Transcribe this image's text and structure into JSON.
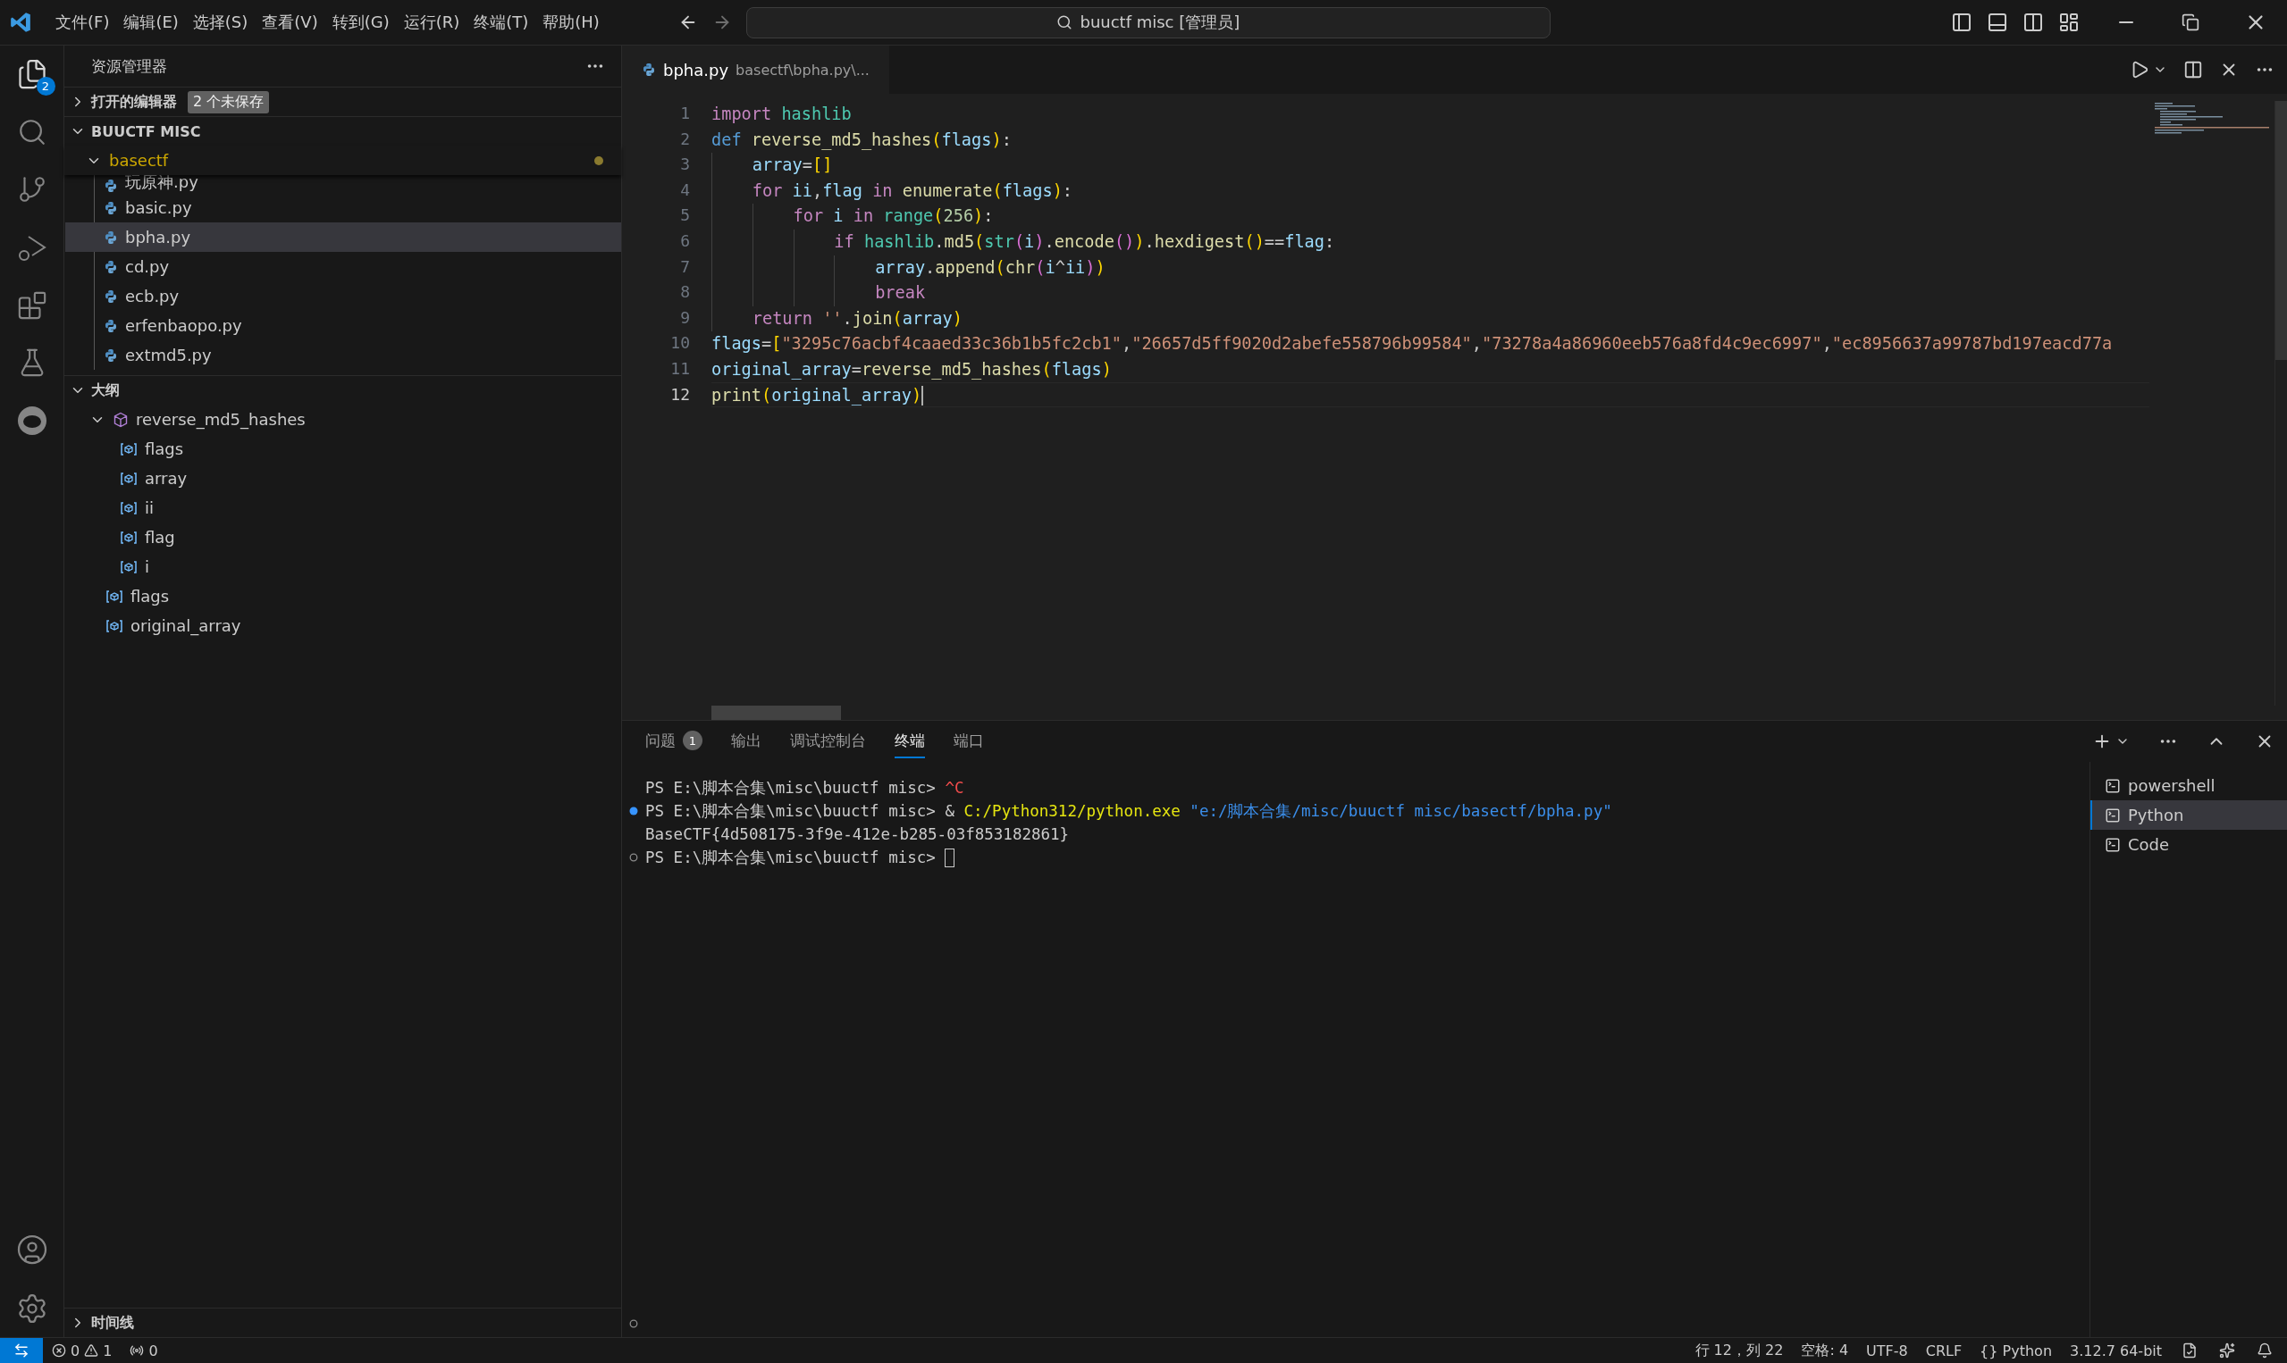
{
  "title_bar": {
    "menus": [
      "文件(F)",
      "编辑(E)",
      "选择(S)",
      "查看(V)",
      "转到(G)",
      "运行(R)",
      "终端(T)",
      "帮助(H)"
    ],
    "search": "buuctf misc [管理员]"
  },
  "activity_bar": {
    "explorer_badge": "2"
  },
  "sidebar": {
    "title": "资源管理器",
    "open_editors": {
      "label": "打开的编辑器",
      "expanded": false,
      "badge": "2 个未保存"
    },
    "workspace": {
      "label": "BUUCTF MISC",
      "expanded": true,
      "folder": {
        "name": "basectf",
        "expanded": true,
        "modified": true,
        "files": [
          {
            "name": "玩原神.py",
            "selected": false
          },
          {
            "name": "basic.py",
            "selected": false
          },
          {
            "name": "bpha.py",
            "selected": true
          },
          {
            "name": "cd.py",
            "selected": false
          },
          {
            "name": "ecb.py",
            "selected": false
          },
          {
            "name": "erfenbaopo.py",
            "selected": false
          },
          {
            "name": "extmd5.py",
            "selected": false
          }
        ]
      }
    },
    "outline": {
      "label": "大纲",
      "expanded": true,
      "items": [
        {
          "name": "reverse_md5_hashes",
          "kind": "method",
          "expanded": true,
          "children": [
            {
              "name": "flags",
              "kind": "variable"
            },
            {
              "name": "array",
              "kind": "variable"
            },
            {
              "name": "ii",
              "kind": "variable"
            },
            {
              "name": "flag",
              "kind": "variable"
            },
            {
              "name": "i",
              "kind": "variable"
            }
          ]
        },
        {
          "name": "flags",
          "kind": "variable"
        },
        {
          "name": "original_array",
          "kind": "variable"
        }
      ]
    },
    "timeline": {
      "label": "时间线",
      "expanded": false
    }
  },
  "editor": {
    "tab": {
      "name": "bpha.py",
      "description": "basectf\\bpha.py\\..."
    },
    "lines": [
      {
        "number": "1",
        "current": false,
        "tokens": [
          {
            "kind": "kw",
            "text": "import "
          },
          {
            "kind": "cls",
            "text": "hashlib"
          }
        ]
      },
      {
        "number": "2",
        "current": false,
        "tokens": [
          {
            "kind": "def",
            "text": "def "
          },
          {
            "kind": "fn",
            "text": "reverse_md5_hashes"
          },
          {
            "kind": "b1",
            "text": "("
          },
          {
            "kind": "var",
            "text": "flags"
          },
          {
            "kind": "b1",
            "text": ")"
          },
          {
            "kind": "plain",
            "text": ":"
          }
        ]
      },
      {
        "number": "3",
        "current": false,
        "tokens": [
          {
            "kind": "var",
            "text": "    array"
          },
          {
            "kind": "plain",
            "text": "="
          },
          {
            "kind": "b1",
            "text": "[]"
          }
        ]
      },
      {
        "number": "4",
        "current": false,
        "tokens": [
          {
            "kind": "kw",
            "text": "    for "
          },
          {
            "kind": "var",
            "text": "ii"
          },
          {
            "kind": "plain",
            "text": ","
          },
          {
            "kind": "var",
            "text": "flag"
          },
          {
            "kind": "kw",
            "text": " in "
          },
          {
            "kind": "fn",
            "text": "enumerate"
          },
          {
            "kind": "b1",
            "text": "("
          },
          {
            "kind": "var",
            "text": "flags"
          },
          {
            "kind": "b1",
            "text": ")"
          },
          {
            "kind": "plain",
            "text": ":"
          }
        ]
      },
      {
        "number": "5",
        "current": false,
        "tokens": [
          {
            "kind": "kw",
            "text": "        for "
          },
          {
            "kind": "var",
            "text": "i"
          },
          {
            "kind": "kw",
            "text": " in "
          },
          {
            "kind": "cls",
            "text": "range"
          },
          {
            "kind": "b1",
            "text": "("
          },
          {
            "kind": "num",
            "text": "256"
          },
          {
            "kind": "b1",
            "text": ")"
          },
          {
            "kind": "plain",
            "text": ":"
          }
        ]
      },
      {
        "number": "6",
        "current": false,
        "tokens": [
          {
            "kind": "kw",
            "text": "            if "
          },
          {
            "kind": "cls",
            "text": "hashlib"
          },
          {
            "kind": "plain",
            "text": "."
          },
          {
            "kind": "fn",
            "text": "md5"
          },
          {
            "kind": "b1",
            "text": "("
          },
          {
            "kind": "cls",
            "text": "str"
          },
          {
            "kind": "b2",
            "text": "("
          },
          {
            "kind": "var",
            "text": "i"
          },
          {
            "kind": "b2",
            "text": ")"
          },
          {
            "kind": "plain",
            "text": "."
          },
          {
            "kind": "fn",
            "text": "encode"
          },
          {
            "kind": "b2",
            "text": "()"
          },
          {
            "kind": "b1",
            "text": ")"
          },
          {
            "kind": "plain",
            "text": "."
          },
          {
            "kind": "fn",
            "text": "hexdigest"
          },
          {
            "kind": "b1",
            "text": "()"
          },
          {
            "kind": "plain",
            "text": "=="
          },
          {
            "kind": "var",
            "text": "flag"
          },
          {
            "kind": "plain",
            "text": ":"
          }
        ]
      },
      {
        "number": "7",
        "current": false,
        "tokens": [
          {
            "kind": "var",
            "text": "                array"
          },
          {
            "kind": "plain",
            "text": "."
          },
          {
            "kind": "fn",
            "text": "append"
          },
          {
            "kind": "b1",
            "text": "("
          },
          {
            "kind": "fn",
            "text": "chr"
          },
          {
            "kind": "b2",
            "text": "("
          },
          {
            "kind": "var",
            "text": "i"
          },
          {
            "kind": "plain",
            "text": "^"
          },
          {
            "kind": "var",
            "text": "ii"
          },
          {
            "kind": "b2",
            "text": ")"
          },
          {
            "kind": "b1",
            "text": ")"
          }
        ]
      },
      {
        "number": "8",
        "current": false,
        "tokens": [
          {
            "kind": "kw",
            "text": "                break"
          }
        ]
      },
      {
        "number": "9",
        "current": false,
        "tokens": [
          {
            "kind": "kw",
            "text": "    return "
          },
          {
            "kind": "str",
            "text": "''"
          },
          {
            "kind": "plain",
            "text": "."
          },
          {
            "kind": "fn",
            "text": "join"
          },
          {
            "kind": "b1",
            "text": "("
          },
          {
            "kind": "var",
            "text": "array"
          },
          {
            "kind": "b1",
            "text": ")"
          }
        ]
      },
      {
        "number": "10",
        "current": false,
        "tokens": [
          {
            "kind": "var",
            "text": "flags"
          },
          {
            "kind": "plain",
            "text": "="
          },
          {
            "kind": "b1",
            "text": "["
          },
          {
            "kind": "str",
            "text": "\"3295c76acbf4caaed33c36b1b5fc2cb1\""
          },
          {
            "kind": "plain",
            "text": ","
          },
          {
            "kind": "str",
            "text": "\"26657d5ff9020d2abefe558796b99584\""
          },
          {
            "kind": "plain",
            "text": ","
          },
          {
            "kind": "str",
            "text": "\"73278a4a86960eeb576a8fd4c9ec6997\""
          },
          {
            "kind": "plain",
            "text": ","
          },
          {
            "kind": "str",
            "text": "\"ec8956637a99787bd197eacd77a"
          }
        ]
      },
      {
        "number": "11",
        "current": false,
        "tokens": [
          {
            "kind": "var",
            "text": "original_array"
          },
          {
            "kind": "plain",
            "text": "="
          },
          {
            "kind": "fn",
            "text": "reverse_md5_hashes"
          },
          {
            "kind": "b1",
            "text": "("
          },
          {
            "kind": "var",
            "text": "flags"
          },
          {
            "kind": "b1",
            "text": ")"
          }
        ]
      },
      {
        "number": "12",
        "current": true,
        "tokens": [
          {
            "kind": "fn",
            "text": "print"
          },
          {
            "kind": "b1",
            "text": "("
          },
          {
            "kind": "var",
            "text": "original_array"
          },
          {
            "kind": "b1",
            "text": ")"
          }
        ]
      }
    ]
  },
  "panel": {
    "tabs": [
      {
        "label": "问题",
        "badge": "1",
        "selected": false
      },
      {
        "label": "输出",
        "selected": false
      },
      {
        "label": "调试控制台",
        "selected": false
      },
      {
        "label": "终端",
        "selected": true
      },
      {
        "label": "端口",
        "selected": false
      }
    ],
    "terminal_lines": [
      {
        "kind": "plain",
        "tokens": [
          {
            "kind": "plain",
            "text": "PS E:\\脚本合集\\misc\\buuctf misc> "
          },
          {
            "kind": "err",
            "text": "^C"
          }
        ]
      },
      {
        "kind": "success",
        "tokens": [
          {
            "kind": "plain",
            "text": "PS E:\\脚本合集\\misc\\buuctf misc> & "
          },
          {
            "kind": "exe",
            "text": "C:/Python312/python.exe"
          },
          {
            "kind": "str",
            "text": " \"e:/脚本合集/misc/buuctf misc/basectf/bpha.py\""
          }
        ]
      },
      {
        "kind": "plain",
        "tokens": [
          {
            "kind": "plain",
            "text": "BaseCTF{4d508175-3f9e-412e-b285-03f853182861}"
          }
        ]
      },
      {
        "kind": "pending",
        "cursor": true,
        "tokens": [
          {
            "kind": "plain",
            "text": "PS E:\\脚本合集\\misc\\buuctf misc> "
          }
        ]
      }
    ],
    "terminals": [
      {
        "name": "powershell",
        "selected": false
      },
      {
        "name": "Python",
        "selected": true
      },
      {
        "name": "Code",
        "selected": false
      }
    ]
  },
  "status_bar": {
    "errors": "0",
    "warnings": "1",
    "ports": "0",
    "position": "行 12，列 22",
    "spaces": "空格: 4",
    "encoding": "UTF-8",
    "eol": "CRLF",
    "language": "{} Python",
    "interpreter": "3.12.7 64-bit"
  }
}
